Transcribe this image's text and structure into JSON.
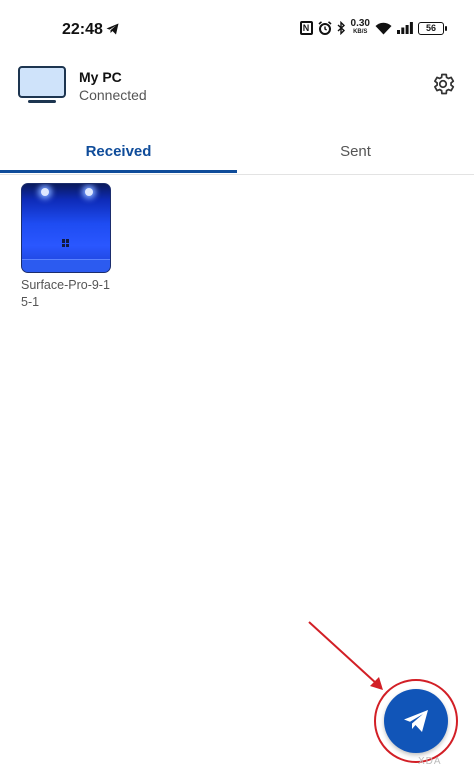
{
  "status_bar": {
    "time": "22:48",
    "nfc_label": "N",
    "net_speed_value": "0.30",
    "net_speed_unit": "KB/S",
    "battery_level": "56",
    "icons": [
      "telegram-icon",
      "nfc-icon",
      "alarm-icon",
      "bluetooth-icon",
      "wifi-icon",
      "signal-icon",
      "battery-icon"
    ]
  },
  "device": {
    "name": "My PC",
    "status": "Connected",
    "icon": "monitor-icon",
    "settings_icon": "gear-icon"
  },
  "tabs": [
    {
      "label": "Received",
      "selected": true
    },
    {
      "label": "Sent",
      "selected": false
    }
  ],
  "files": [
    {
      "name": "Surface-Pro-9-15-1"
    }
  ],
  "fab": {
    "icon": "send-icon",
    "highlighted": true
  },
  "watermark": "XDA",
  "colors": {
    "accent": "#0f4c9a",
    "fab": "#1155b8",
    "annotation": "#d21f26"
  }
}
